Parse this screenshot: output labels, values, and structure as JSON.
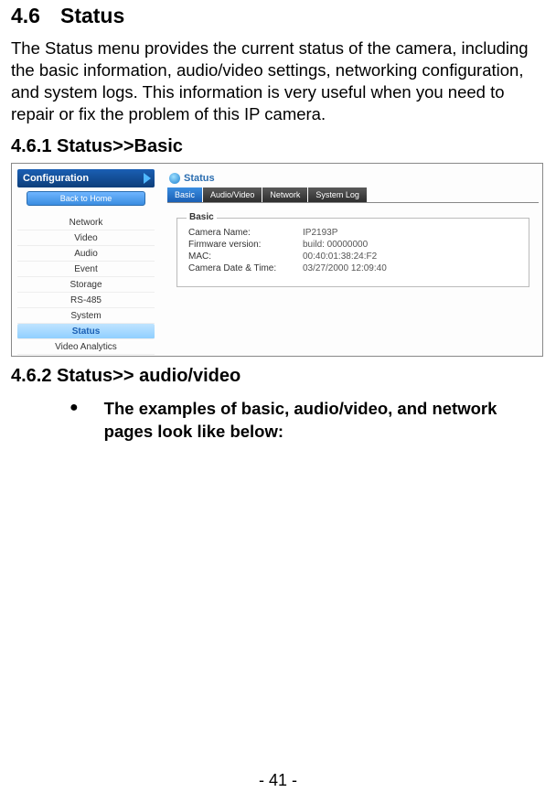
{
  "section": {
    "number": "4.6",
    "title": "Status",
    "description": "The Status menu provides the current status of the camera, including the basic information, audio/video settings, networking configuration, and system logs.  This information is very useful when you need to repair or fix the problem of this IP camera."
  },
  "sub1": {
    "heading": "4.6.1 Status>>Basic"
  },
  "sub2": {
    "heading": "4.6.2 Status>> audio/video",
    "bullet": "The examples of basic, audio/video, and network pages look like below:"
  },
  "screenshot": {
    "configLabel": "Configuration",
    "backLabel": "Back to Home",
    "nav": [
      "Network",
      "Video",
      "Audio",
      "Event",
      "Storage",
      "RS-485",
      "System",
      "Status",
      "Video Analytics"
    ],
    "activeNav": 7,
    "statusTitle": "Status",
    "tabs": [
      "Basic",
      "Audio/Video",
      "Network",
      "System Log"
    ],
    "activeTab": 0,
    "fieldsetLegend": "Basic",
    "fields": [
      {
        "label": "Camera Name:",
        "value": "IP2193P"
      },
      {
        "label": "Firmware version:",
        "value": "build: 00000000"
      },
      {
        "label": "MAC:",
        "value": "00:40:01:38:24:F2"
      },
      {
        "label": "Camera Date & Time:",
        "value": "03/27/2000 12:09:40"
      }
    ]
  },
  "pageNumber": "- 41 -"
}
